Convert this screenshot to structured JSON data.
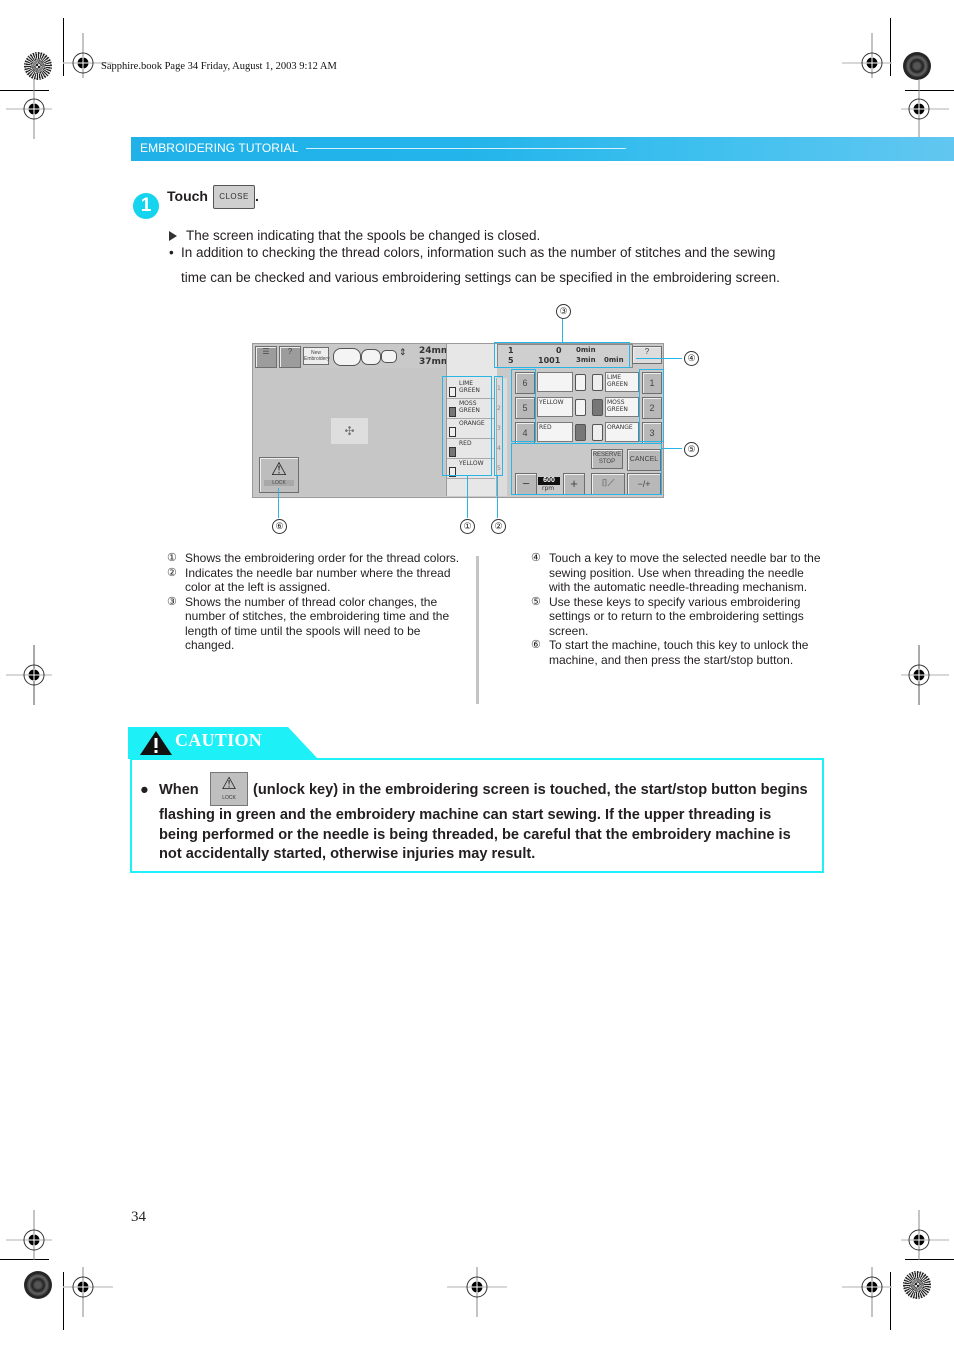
{
  "print_info": "Sapphire.book  Page 34  Friday, August 1, 2003  9:12 AM",
  "header": {
    "section_title": "EMBROIDERING TUTORIAL"
  },
  "step": {
    "number": "1",
    "instruction_prefix": "Touch",
    "button_label": "CLOSE",
    "instruction_suffix": ".",
    "result_text": "The screen indicating that the spools be changed is closed.",
    "bullet_line1": "In addition to checking the thread colors, information such as the number of stitches and the sewing",
    "bullet_line2": "time can be checked and various embroidering settings can be specified in the embroidering screen."
  },
  "lcd": {
    "top_bar": {
      "new_embroidery_label": "New Embroidery",
      "size_height": "24mm",
      "size_width": "37mm"
    },
    "lock_label": "LOCK",
    "info": {
      "color_current": "1",
      "color_total": "5",
      "stitch_current": "0",
      "stitch_total": "1001",
      "time_current": "0min",
      "time_total": "3min",
      "time_until_change": "0min"
    },
    "thread_list": [
      {
        "name": "LIME GREEN",
        "needle": "1"
      },
      {
        "name": "MOSS GREEN",
        "needle": "2"
      },
      {
        "name": "ORANGE",
        "needle": "3"
      },
      {
        "name": "RED",
        "needle": "4"
      },
      {
        "name": "YELLOW",
        "needle": "5"
      }
    ],
    "needle_left": [
      "6",
      "5",
      "4"
    ],
    "needle_right": [
      "1",
      "2",
      "3"
    ],
    "left_spool_labels": [
      "",
      "YELLOW",
      "RED"
    ],
    "right_spool_labels": [
      "LIME GREEN",
      "MOSS GREEN",
      "ORANGE"
    ],
    "reserve_stop_label": "RESERVE STOP",
    "cancel_label": "CANCEL",
    "speed_value": "600",
    "speed_unit": "rpm",
    "minus_label": "−",
    "plus_label": "+",
    "needle_adjust_label": "−/+"
  },
  "callouts": [
    "①",
    "②",
    "③",
    "④",
    "⑤",
    "⑥"
  ],
  "descriptions_left": [
    {
      "num": "①",
      "text": "Shows the embroidering order for the thread colors."
    },
    {
      "num": "②",
      "text": "Indicates the needle bar number where the thread color at the left is assigned."
    },
    {
      "num": "③",
      "text": "Shows the number of thread color changes, the number of stitches, the embroidering time and the length of time until the spools will need to be changed."
    }
  ],
  "descriptions_right": [
    {
      "num": "④",
      "text": "Touch a key to move the selected needle bar to the sewing position. Use when threading the needle with the automatic needle-threading mechanism."
    },
    {
      "num": "⑤",
      "text": "Use these keys to specify various embroidering settings or to return to the embroidering settings screen."
    },
    {
      "num": "⑥",
      "text": "To start the machine, touch this key to unlock the machine, and then press the start/stop button."
    }
  ],
  "caution": {
    "title": "CAUTION",
    "when": "When",
    "lock_label": "LOCK",
    "line1_rest": "(unlock key) in the embroidering screen is touched, the start/stop button begins",
    "line2": "flashing in green and the embroidery machine can start sewing. If the upper threading is",
    "line3": "being performed or the needle is being threaded, be careful that the embroidery machine is",
    "line4": "not accidentally started, otherwise injuries may result."
  },
  "page_number": "34",
  "colors": {
    "band": "#1fb1e8",
    "caution": "#1ef0f8",
    "highlight": "#2ab5e2"
  }
}
